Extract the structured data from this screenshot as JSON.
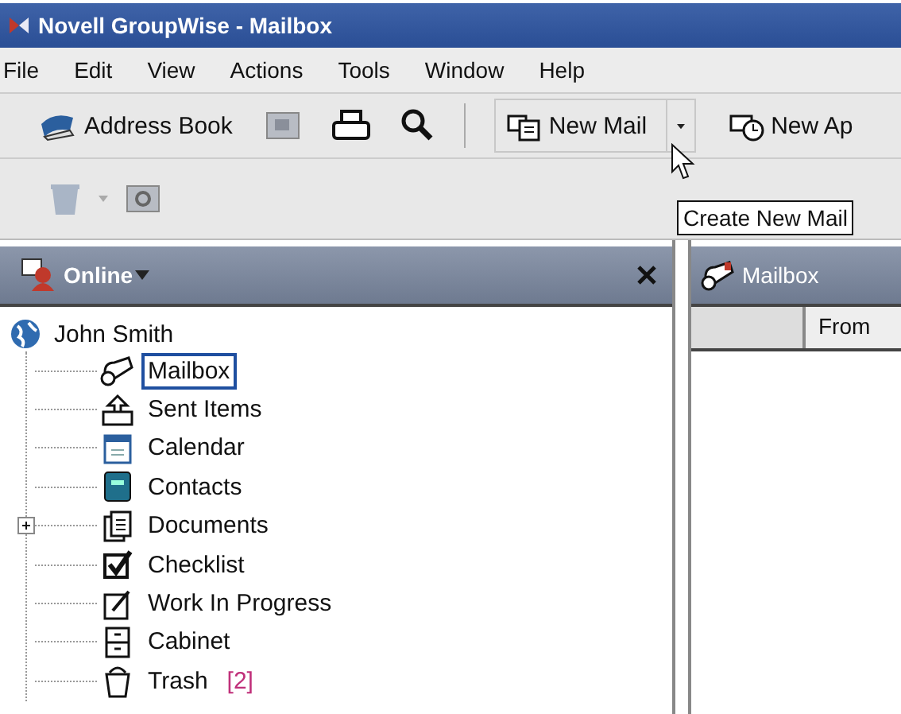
{
  "window": {
    "title": "Novell GroupWise - Mailbox"
  },
  "menu": [
    "File",
    "Edit",
    "View",
    "Actions",
    "Tools",
    "Window",
    "Help"
  ],
  "toolbar": {
    "address_book": "Address Book",
    "new_mail": "New Mail",
    "new_appointment": "New Ap"
  },
  "tooltip": "Create New Mail",
  "folder_pane": {
    "mode": "Online",
    "root": "John Smith",
    "folders": [
      {
        "label": "Mailbox",
        "kind": "mailbox",
        "selected": true,
        "expandable": false
      },
      {
        "label": "Sent Items",
        "kind": "sent",
        "selected": false,
        "expandable": false
      },
      {
        "label": "Calendar",
        "kind": "calendar",
        "selected": false,
        "expandable": false
      },
      {
        "label": "Contacts",
        "kind": "contacts",
        "selected": false,
        "expandable": false
      },
      {
        "label": "Documents",
        "kind": "documents",
        "selected": false,
        "expandable": true
      },
      {
        "label": "Checklist",
        "kind": "checklist",
        "selected": false,
        "expandable": false
      },
      {
        "label": "Work In Progress",
        "kind": "work",
        "selected": false,
        "expandable": false
      },
      {
        "label": "Cabinet",
        "kind": "cabinet",
        "selected": false,
        "expandable": false
      },
      {
        "label": "Trash",
        "kind": "trash",
        "selected": false,
        "expandable": false,
        "count": "[2]"
      }
    ]
  },
  "content": {
    "title": "Mailbox",
    "columns": [
      "From"
    ]
  }
}
